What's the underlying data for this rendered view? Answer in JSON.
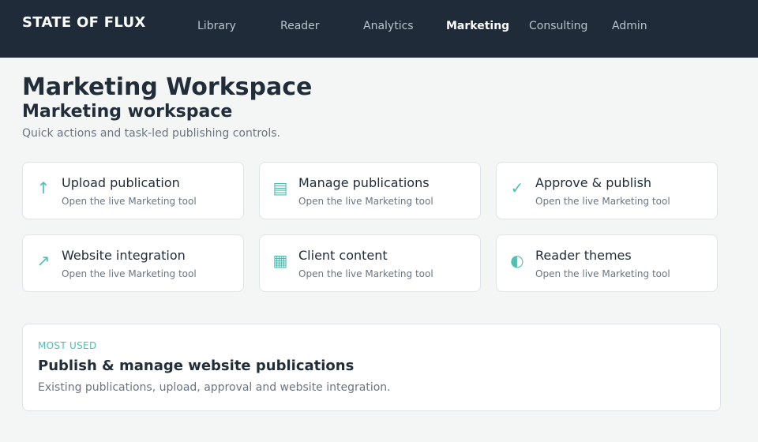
{
  "brand": "STATE OF FLUX",
  "nav": {
    "items": [
      {
        "label": "Library"
      },
      {
        "label": "Reader"
      },
      {
        "label": "Analytics"
      },
      {
        "label": "Marketing",
        "active": true
      },
      {
        "label": "Consulting"
      },
      {
        "label": "Admin"
      }
    ]
  },
  "page": {
    "title": "Marketing Workspace",
    "heading": "Marketing workspace",
    "subtitle": "Quick actions and task-led publishing controls."
  },
  "cards": [
    {
      "icon": "up-arrow-icon",
      "glyph": "↑",
      "title": "Upload publication",
      "desc": "Open the live Marketing tool"
    },
    {
      "icon": "list-icon",
      "glyph": "▤",
      "title": "Manage publications",
      "desc": "Open the live Marketing tool"
    },
    {
      "icon": "check-icon",
      "glyph": "✓",
      "title": "Approve & publish",
      "desc": "Open the live Marketing tool"
    },
    {
      "icon": "diagonal-arrow-icon",
      "glyph": "↗",
      "title": "Website integration",
      "desc": "Open the live Marketing tool"
    },
    {
      "icon": "grid-icon",
      "glyph": "▦",
      "title": "Client content",
      "desc": "Open the live Marketing tool"
    },
    {
      "icon": "half-circle-icon",
      "glyph": "◐",
      "title": "Reader themes",
      "desc": "Open the live Marketing tool"
    }
  ],
  "feature": {
    "eyebrow": "MOST USED",
    "title": "Publish & manage website publications",
    "desc": "Existing publications, upload, approval and website integration."
  },
  "colors": {
    "topbar": "#1f2b39",
    "accent": "#4fc0b0",
    "background": "#f4f6f5"
  }
}
